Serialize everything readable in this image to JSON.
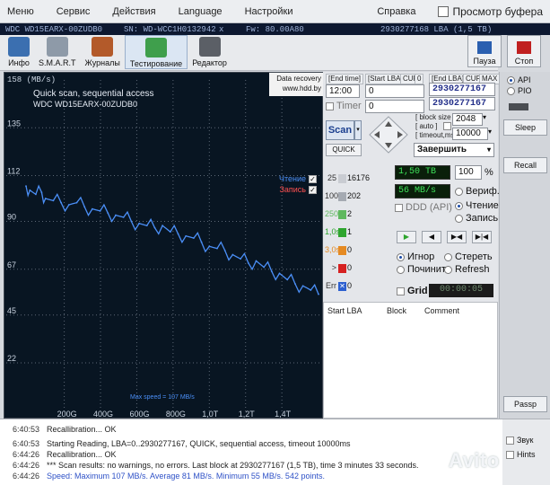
{
  "menu": [
    "Меню",
    "Сервис",
    "Действия",
    "Language",
    "Настройки",
    "Справка"
  ],
  "buffer_viewer": "Просмотр буфера",
  "status": {
    "model": "WDC WD15EARX-00ZUDB0",
    "serial": "SN: WD-WCC1H0132942",
    "x": "x",
    "fw": "Fw: 80.00A80",
    "capacity": "2930277168 LBA (1,5 TB)"
  },
  "toolbar": {
    "info": "Инфо",
    "smart": "S.M.A.R.T",
    "logs": "Журналы",
    "test": "Тестирование",
    "editor": "Редактор",
    "pause": "Пауза",
    "stop": "Стоп"
  },
  "graph": {
    "speed_unit": "158 (MB/s)",
    "title": "Quick scan, sequential access",
    "model": "WDC WD15EARX-00ZUDB0",
    "brand_line1": "Data recovery",
    "brand_line2": "www.hdd.by",
    "legend_read": "Чтение",
    "legend_write": "Запись",
    "legend_check": "✓",
    "max_speed_label": "Max speed = 107 MB/s",
    "colors": {
      "background": "#081522",
      "read_line": "#4b8ff7",
      "write_line": "#ff5050",
      "grid": "#5c6775"
    }
  },
  "chart_data": {
    "type": "line",
    "title": "Quick scan, sequential access",
    "ylabel": "(MB/s)",
    "xlabel": "",
    "ylim": [
      0,
      158
    ],
    "xlim": [
      0,
      1.5
    ],
    "y_ticks": [
      135,
      112,
      90,
      67,
      45,
      22
    ],
    "x_ticks": [
      "200G",
      "400G",
      "600G",
      "800G",
      "1,0T",
      "1,2T",
      "1,4T"
    ],
    "series": [
      {
        "name": "Чтение",
        "x": [
          0.0,
          0.02,
          0.05,
          0.08,
          0.1,
          0.14,
          0.18,
          0.22,
          0.26,
          0.3,
          0.34,
          0.38,
          0.42,
          0.46,
          0.5,
          0.54,
          0.58,
          0.62,
          0.66,
          0.7,
          0.74,
          0.78,
          0.82,
          0.86,
          0.9,
          0.94,
          0.98,
          1.02,
          1.06,
          1.1,
          1.14,
          1.18,
          1.22,
          1.26,
          1.3,
          1.34,
          1.38,
          1.42,
          1.46,
          1.5
        ],
        "values": [
          107,
          105,
          103,
          104,
          101,
          100,
          99,
          98,
          99,
          97,
          96,
          95,
          94,
          93,
          92,
          90,
          89,
          88,
          87,
          88,
          85,
          84,
          83,
          82,
          80,
          78,
          77,
          76,
          74,
          72,
          70,
          71,
          68,
          66,
          65,
          62,
          60,
          59,
          57,
          55
        ]
      }
    ]
  },
  "controls": {
    "end_time_label": "[End time]",
    "start_lba_label": "[Start LBA]",
    "cur_label": "CUR",
    "zero_label": "0",
    "end_lba_label": "[End LBA]",
    "cur2_label": "CUR",
    "max_label": "MAX",
    "time_value": "12:00",
    "start_lba_value": "0",
    "end_lba_value": "2930277167",
    "current_lba_value": "2930277167",
    "timer_label": "Timer",
    "timer_value": "0",
    "scan": "Scan",
    "quick": "QUICK",
    "block_size_label": "[ block size ]",
    "auto_label": "[ auto ]",
    "timeout_label": "[ timeout,ms ]",
    "block_size_value": "2048",
    "timeout_value": "10000",
    "action_value": "Завершить",
    "blocks": [
      {
        "label": "25",
        "count": "16176",
        "color": "#c9ccd2"
      },
      {
        "label": "100",
        "count": "202",
        "color": "#a5aab2"
      },
      {
        "label": "250",
        "count": "2",
        "color": "#5fb85f"
      },
      {
        "label": "1,0s",
        "count": "1",
        "color": "#2ea52e"
      },
      {
        "label": "3,0s",
        "count": "0",
        "color": "#e58a22"
      },
      {
        "label": ">",
        "count": "0",
        "color": "#d62121"
      },
      {
        "label": "Err",
        "count": "0",
        "color": "#2c5fd0"
      }
    ],
    "err_x": "✕",
    "capacity_lcd": "1,50 TB",
    "percent": "100",
    "percent_sign": "%",
    "speed_lcd": "56 MB/s",
    "verify": "Вериф.",
    "read": "Чтение",
    "write": "Запись",
    "ddd_api": "DDD (API)",
    "ignore": "Игнор",
    "erase": "Стереть",
    "repair": "Починить",
    "refresh": "Refresh",
    "grid": "Grid",
    "grid_timer": "00:00:05"
  },
  "table": {
    "start_lba": "Start LBA",
    "block": "Block",
    "comment": "Comment"
  },
  "sidebar": {
    "api": "API",
    "pio": "PIO",
    "sleep": "Sleep",
    "recall": "Recall",
    "passp": "Passp"
  },
  "log": [
    {
      "time": "6:40:53",
      "msg": "Recallibration... OK",
      "blue": false
    },
    {
      "time": "6:40:53",
      "msg": "Starting Reading, LBA=0..2930277167, QUICK, sequential access, timeout 10000ms",
      "blue": false
    },
    {
      "time": "6:44:26",
      "msg": "Recallibration... OK",
      "blue": false
    },
    {
      "time": "6:44:26",
      "msg": "*** Scan results: no warnings, no errors. Last block at 2930277167 (1,5 TB), time 3 minutes 33 seconds.",
      "blue": false
    },
    {
      "time": "6:44:26",
      "msg": "Speed: Maximum 107 MB/s. Average 81 MB/s. Minimum 55 MB/s. 542 points.",
      "blue": true
    }
  ],
  "bottom_right": {
    "sound": "Звук",
    "hints": "Hints"
  },
  "watermark": "Avito"
}
